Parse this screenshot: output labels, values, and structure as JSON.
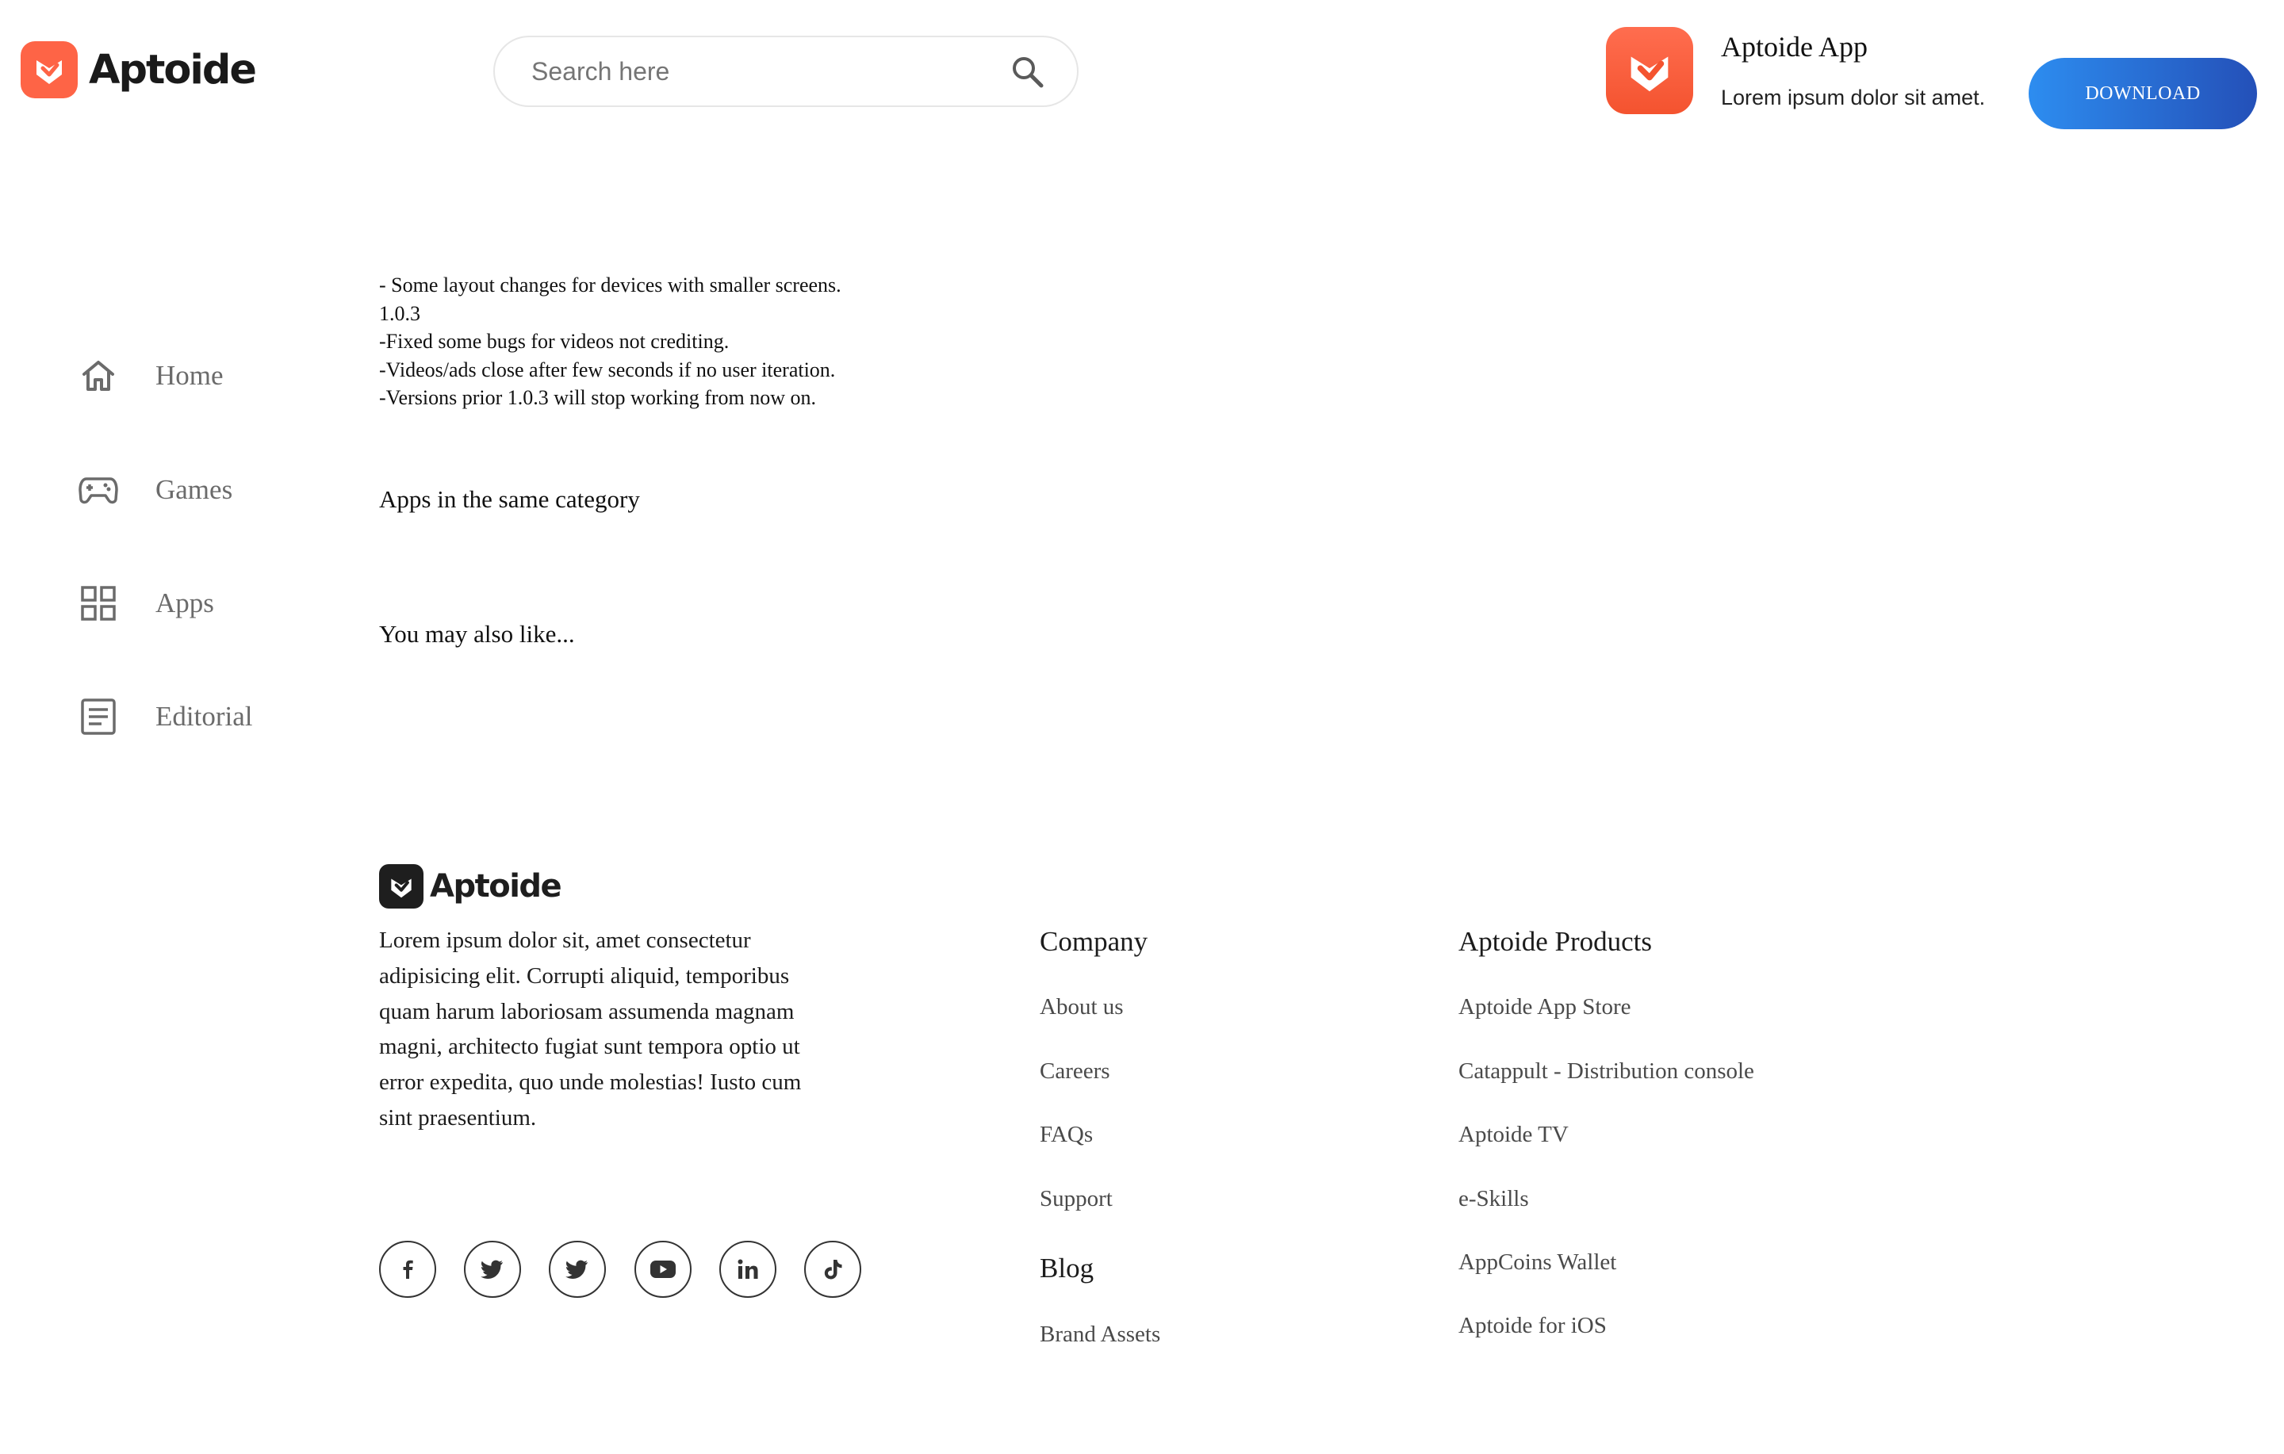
{
  "brand": {
    "name": "Aptoide",
    "accent": "#fe6446"
  },
  "search": {
    "placeholder": "Search here"
  },
  "promo": {
    "title": "Aptoide App",
    "subtitle": "Lorem ipsum dolor sit amet.",
    "button": "DOWNLOAD",
    "button_gradient": [
      "#2d8df0",
      "#2450b8"
    ]
  },
  "sidebar": {
    "items": [
      {
        "label": "Home",
        "icon": "home-icon"
      },
      {
        "label": "Games",
        "icon": "gamepad-icon"
      },
      {
        "label": "Apps",
        "icon": "apps-grid-icon"
      },
      {
        "label": "Editorial",
        "icon": "editorial-icon"
      }
    ]
  },
  "changelog": {
    "lines": [
      "- Some layout changes for devices with smaller screens.",
      "1.0.3",
      "-Fixed some bugs for videos not crediting.",
      "-Videos/ads close after few seconds if no user iteration.",
      "-Versions prior 1.0.3 will stop working from now on."
    ]
  },
  "sections": {
    "same_category": "Apps in the same category",
    "also_like": "You may also like..."
  },
  "footer": {
    "brand": "Aptoide",
    "description": "Lorem ipsum dolor sit, amet consectetur adipisicing elit. Corrupti aliquid, temporibus quam harum laboriosam assumenda magnam magni, architecto fugiat sunt tempora optio ut error expedita, quo unde molestias! Iusto cum sint praesentium.",
    "social": [
      "facebook-icon",
      "twitter-icon",
      "twitter-icon",
      "youtube-icon",
      "linkedin-icon",
      "tiktok-icon"
    ],
    "company": {
      "title": "Company",
      "links": [
        "About us",
        "Careers",
        "FAQs",
        "Support"
      ],
      "blog": "Blog",
      "brand_assets": "Brand Assets"
    },
    "products": {
      "title": "Aptoide Products",
      "links": [
        "Aptoide App Store",
        "Catappult - Distribution console",
        "Aptoide TV",
        "e-Skills",
        "AppCoins Wallet",
        "Aptoide for iOS"
      ]
    }
  }
}
